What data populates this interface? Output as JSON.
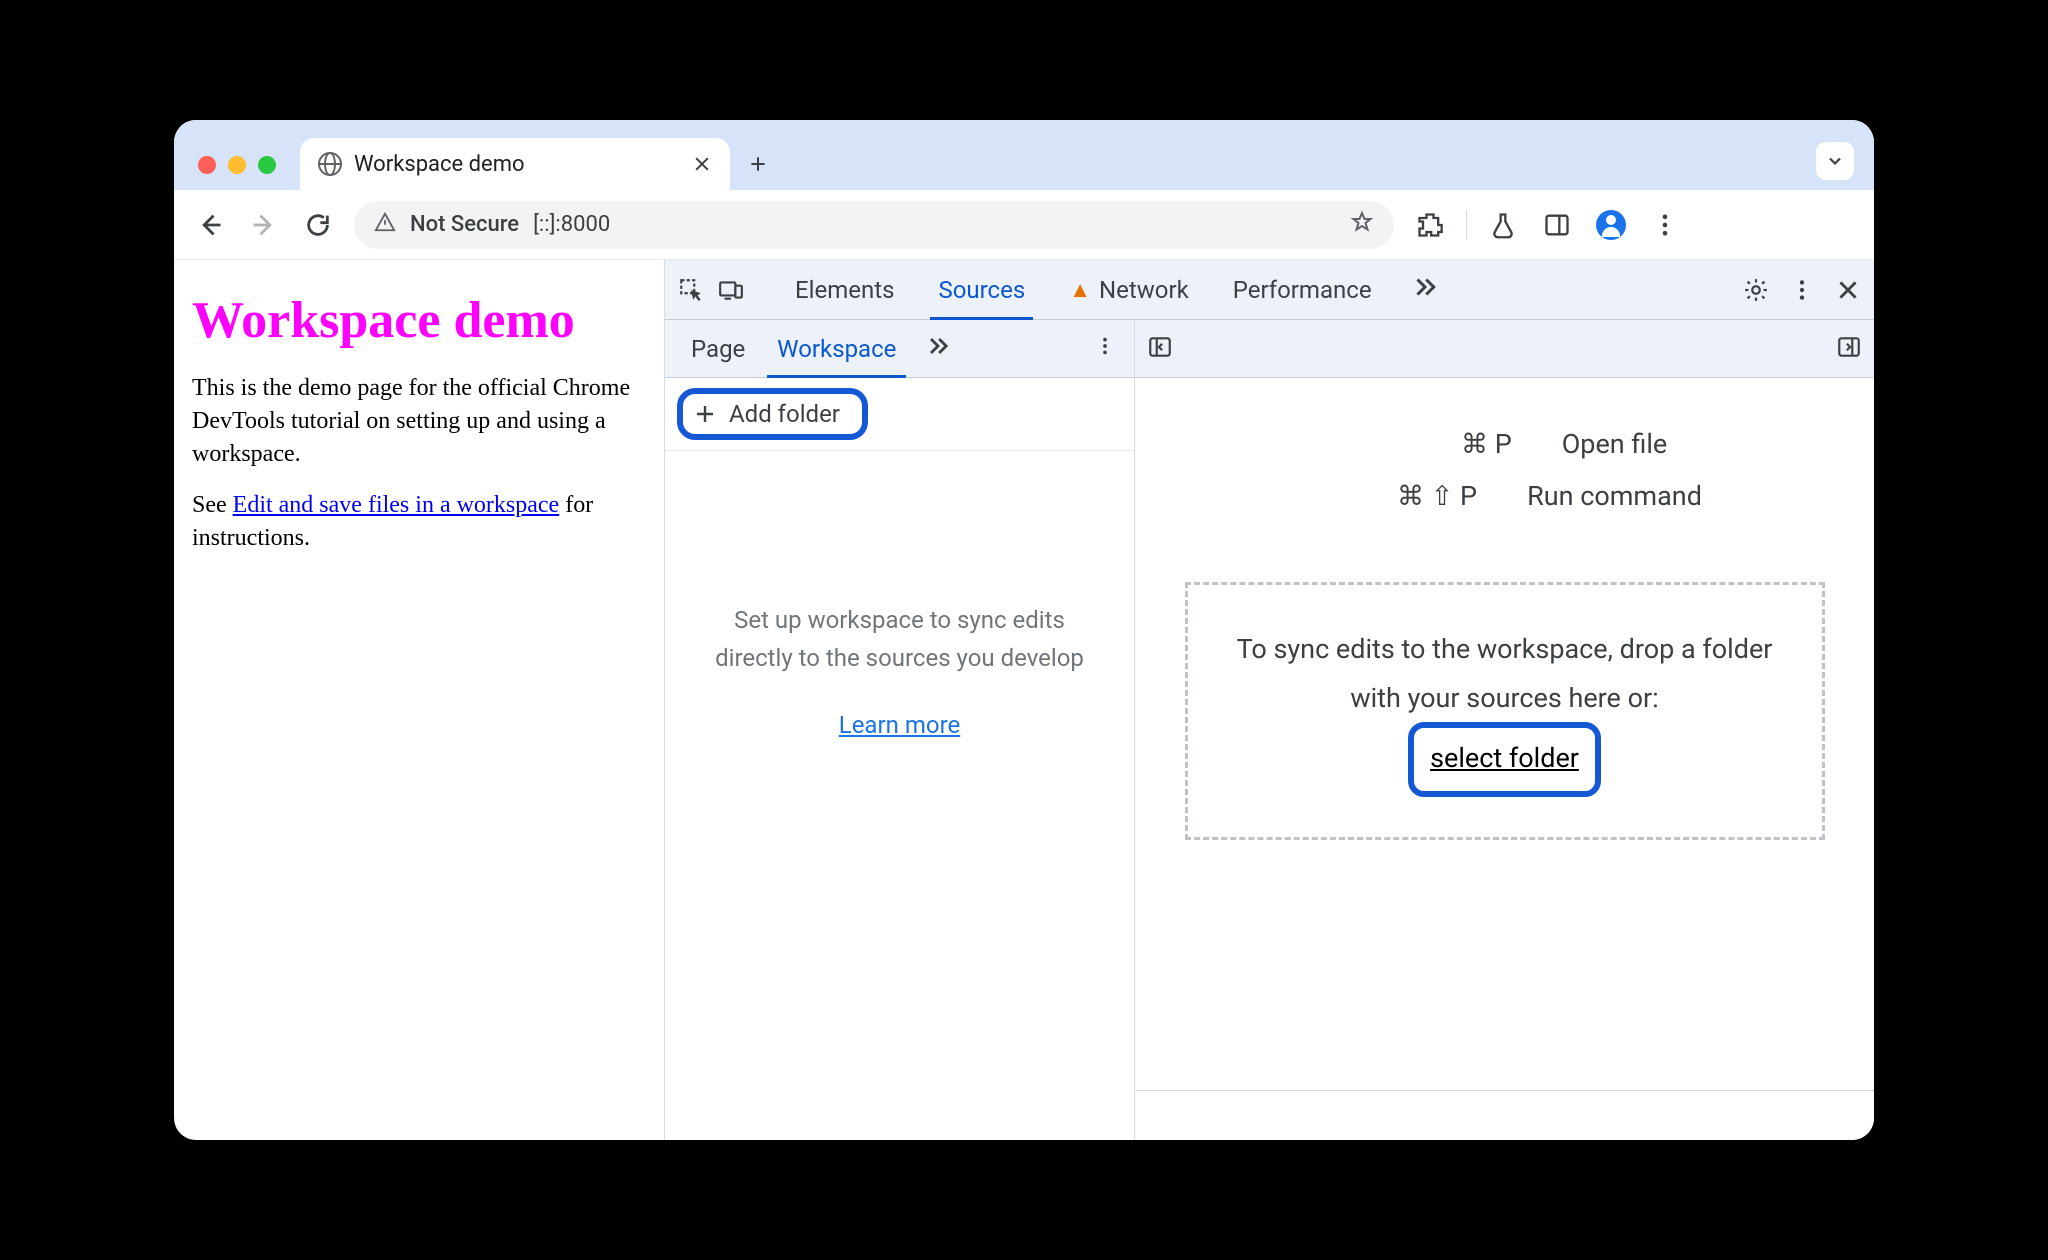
{
  "browser": {
    "tab_title": "Workspace demo",
    "not_secure_label": "Not Secure",
    "url": "[::]:8000"
  },
  "page": {
    "heading": "Workspace demo",
    "para1": "This is the demo page for the official Chrome DevTools tutorial on setting up and using a workspace.",
    "para2_prefix": "See ",
    "para2_link": "Edit and save files in a workspace",
    "para2_suffix": " for instructions."
  },
  "devtools": {
    "tabs": {
      "elements": "Elements",
      "sources": "Sources",
      "network": "Network",
      "performance": "Performance"
    },
    "sources": {
      "subtabs": {
        "page": "Page",
        "workspace": "Workspace"
      },
      "add_folder_label": "Add folder",
      "nav_help": "Set up workspace to sync edits directly to the sources you develop",
      "learn_more": "Learn more",
      "shortcut_open_file_keys": "⌘  P",
      "shortcut_open_file_label": "Open file",
      "shortcut_run_cmd_keys": "⌘  ⇧  P",
      "shortcut_run_cmd_label": "Run command",
      "dropzone_text": "To sync edits to the workspace, drop a folder with your sources here or:",
      "dropzone_link": "select folder"
    }
  }
}
